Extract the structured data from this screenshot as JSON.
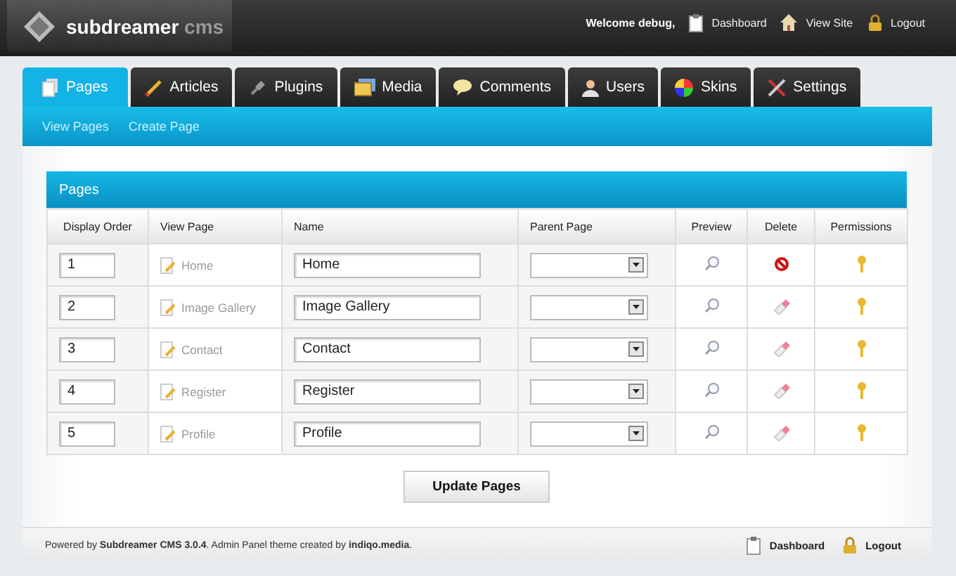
{
  "header": {
    "logo_text": "subdreamer",
    "logo_suffix": "cms",
    "welcome": "Welcome debug,",
    "links": [
      {
        "kind": "dashboard",
        "label": "Dashboard"
      },
      {
        "kind": "site",
        "label": "View Site"
      },
      {
        "kind": "logout",
        "label": "Logout"
      }
    ]
  },
  "tabs": [
    {
      "kind": "pages",
      "label": "Pages",
      "selected": true
    },
    {
      "kind": "articles",
      "label": "Articles",
      "selected": false
    },
    {
      "kind": "plugins",
      "label": "Plugins",
      "selected": false
    },
    {
      "kind": "media",
      "label": "Media",
      "selected": false
    },
    {
      "kind": "comments",
      "label": "Comments",
      "selected": false
    },
    {
      "kind": "users",
      "label": "Users",
      "selected": false
    },
    {
      "kind": "skins",
      "label": "Skins",
      "selected": false
    },
    {
      "kind": "settings",
      "label": "Settings",
      "selected": false
    }
  ],
  "subnav": [
    "View Pages",
    "Create Page"
  ],
  "panel": {
    "title": "Pages",
    "columns": [
      "Display Order",
      "View Page",
      "Name",
      "Parent Page",
      "Preview",
      "Delete",
      "Permissions"
    ],
    "rows": [
      {
        "order": "1",
        "view": "Home",
        "name": "Home",
        "deletable": false
      },
      {
        "order": "2",
        "view": "Image Gallery",
        "name": "Image Gallery",
        "deletable": true
      },
      {
        "order": "3",
        "view": "Contact",
        "name": "Contact",
        "deletable": true
      },
      {
        "order": "4",
        "view": "Register",
        "name": "Register",
        "deletable": true
      },
      {
        "order": "5",
        "view": "Profile",
        "name": "Profile",
        "deletable": true
      }
    ],
    "button": "Update Pages"
  },
  "footer": {
    "credit": "Powered by **Subdreamer CMS 3.0.4**. Admin Panel theme created by **indiqo.media**.",
    "links": [
      {
        "kind": "dashboard",
        "label": "Dashboard"
      },
      {
        "kind": "logout",
        "label": "Logout"
      }
    ]
  }
}
